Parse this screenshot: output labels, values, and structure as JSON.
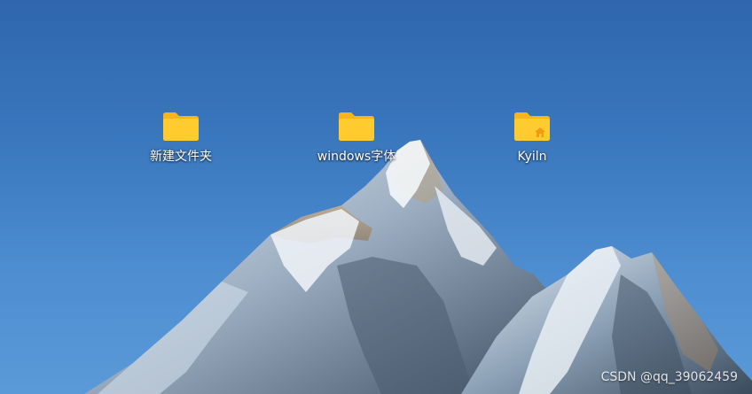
{
  "desktop": {
    "icons": [
      {
        "label": "新建文件夹",
        "icon": "folder-icon"
      },
      {
        "label": "windows字体",
        "icon": "folder-icon"
      },
      {
        "label": "Kyiln",
        "icon": "home-folder-icon"
      }
    ]
  },
  "watermark": "CSDN @qq_39062459",
  "colors": {
    "sky_top": "#2f66ad",
    "sky_bottom": "#5b9ad8",
    "folder": "#ffcb2e",
    "folder_tab": "#f6b51c",
    "snow": "#eef3f8",
    "rock": "#4a5a6c"
  }
}
